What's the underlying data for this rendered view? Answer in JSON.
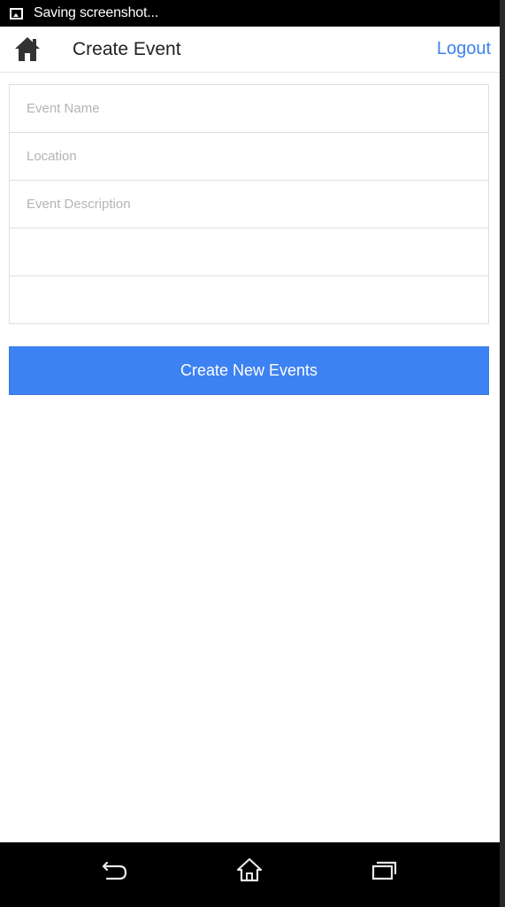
{
  "status_bar": {
    "notification_icon": "image-icon",
    "text": "Saving screenshot..."
  },
  "toolbar": {
    "home_icon": "home-icon",
    "title": "Create Event",
    "logout_label": "Logout",
    "accent_color": "#3b82f0"
  },
  "form": {
    "event_name": {
      "value": "",
      "placeholder": "Event Name"
    },
    "location": {
      "value": "",
      "placeholder": "Location"
    },
    "event_description": {
      "value": "",
      "placeholder": "Event Description"
    },
    "extra_field_1": {
      "value": "",
      "placeholder": ""
    },
    "extra_field_2": {
      "value": "",
      "placeholder": ""
    }
  },
  "create_button": {
    "label": "Create New Events",
    "color": "#3d82f3"
  },
  "nav_bar": {
    "back_icon": "back-icon",
    "home_icon": "home-outline-icon",
    "recents_icon": "recents-icon"
  }
}
